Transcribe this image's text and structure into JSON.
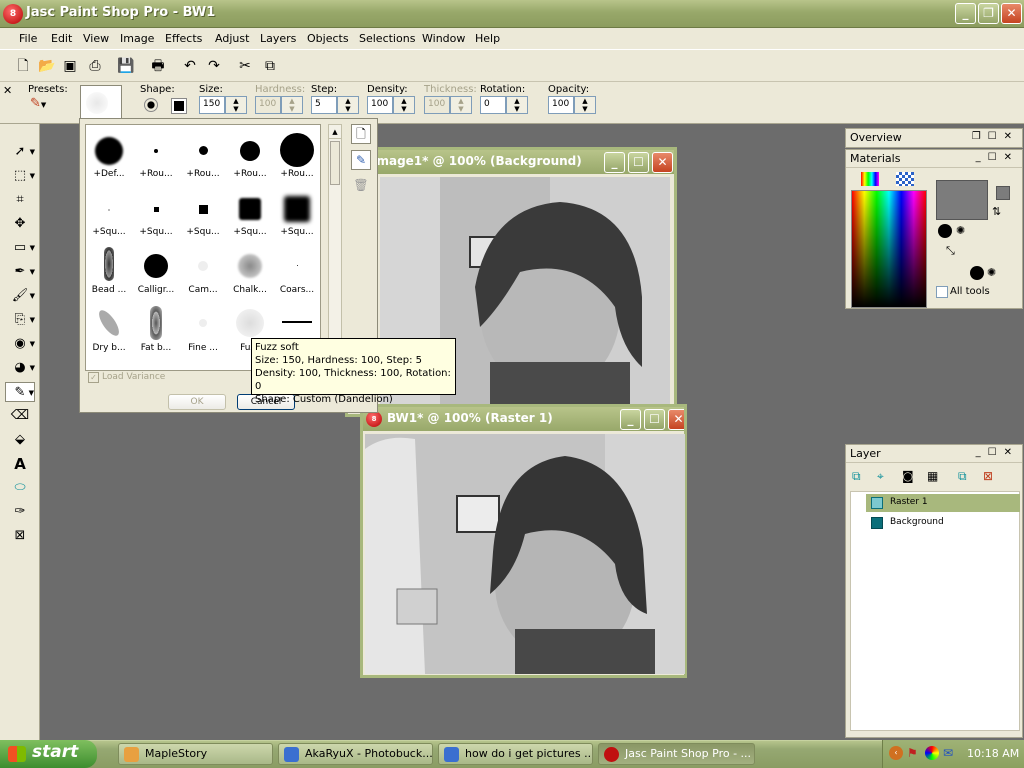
{
  "app": {
    "title": "Jasc Paint Shop Pro - BW1",
    "icon": "paint-shop-pro-icon"
  },
  "menubar": [
    "File",
    "Edit",
    "View",
    "Image",
    "Effects",
    "Adjust",
    "Layers",
    "Objects",
    "Selections",
    "Window",
    "Help"
  ],
  "toolbar": {
    "icons": [
      "new-icon",
      "open-icon",
      "browse-icon",
      "scan-icon",
      "save-icon",
      "print-icon",
      "undo-icon",
      "redo-icon",
      "cut-icon",
      "copy-icon"
    ]
  },
  "options": {
    "presets_label": "Presets:",
    "shape_label": "Shape:",
    "size_label": "Size:",
    "size_value": "150",
    "hardness_label": "Hardness:",
    "hardness_value": "100",
    "step_label": "Step:",
    "step_value": "5",
    "density_label": "Density:",
    "density_value": "100",
    "thickness_label": "Thickness:",
    "thickness_value": "100",
    "rotation_label": "Rotation:",
    "rotation_value": "0",
    "opacity_label": "Opacity:",
    "opacity_value": "100"
  },
  "brushes": {
    "items": [
      "+Def...",
      "+Rou...",
      "+Rou...",
      "+Rou...",
      "+Rou...",
      "+Squ...",
      "+Squ...",
      "+Squ...",
      "+Squ...",
      "+Squ...",
      "Bead ...",
      "Calligr...",
      "Cam...",
      "Chalk...",
      "Coars...",
      "Dry b...",
      "Fat b...",
      "Fine ...",
      "Fuzz",
      ""
    ],
    "load_variance": "Load Variance",
    "ok": "OK",
    "cancel": "Cancel",
    "tooltip": {
      "line1": "Fuzz soft",
      "line2": "Size: 150, Hardness: 100, Step: 5",
      "line3": "Density: 100, Thickness: 100, Rotation: 0",
      "line4": "Shape: Custom (Dandelion)"
    }
  },
  "windows": {
    "top_title": "Image1* @ 100% (Background)",
    "bottom_title": "BW1* @ 100% (Raster 1)"
  },
  "palettes": {
    "overview": "Overview",
    "materials": "Materials",
    "all_tools": "All tools",
    "layer": "Layer",
    "layers": [
      "Raster 1",
      "Background"
    ]
  },
  "taskbar": {
    "start": "start",
    "tasks": [
      "MapleStory",
      "AkaRyuX - Photobuck...",
      "how do i get pictures ...",
      "Jasc Paint Shop Pro - ..."
    ],
    "clock": "10:18 AM"
  },
  "colors": {
    "title_green": "#98a86a",
    "workspace_gray": "#6c6c6c",
    "selected_layer": "#a8b87d"
  }
}
